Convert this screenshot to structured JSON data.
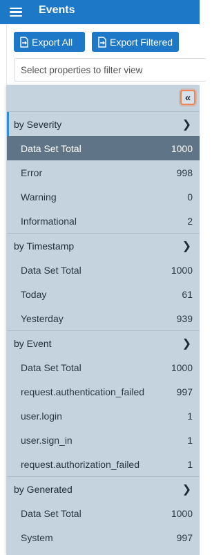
{
  "header": {
    "title": "Events",
    "menu_icon": "hamburger-menu-icon"
  },
  "toolbar": {
    "export_all_label": "Export All",
    "export_filtered_label": "Export Filtered",
    "filter_placeholder": "Select properties to filter view"
  },
  "panel": {
    "collapse_glyph": "«",
    "sections": [
      {
        "label": "by Severity",
        "rows": [
          {
            "label": "Data Set Total",
            "value": "1000"
          },
          {
            "label": "Error",
            "value": "998"
          },
          {
            "label": "Warning",
            "value": "0"
          },
          {
            "label": "Informational",
            "value": "2"
          }
        ]
      },
      {
        "label": "by Timestamp",
        "rows": [
          {
            "label": "Data Set Total",
            "value": "1000"
          },
          {
            "label": "Today",
            "value": "61"
          },
          {
            "label": "Yesterday",
            "value": "939"
          }
        ]
      },
      {
        "label": "by Event",
        "rows": [
          {
            "label": "Data Set Total",
            "value": "1000"
          },
          {
            "label": "request.authentication_failed",
            "value": "997"
          },
          {
            "label": "user.login",
            "value": "1"
          },
          {
            "label": "user.sign_in",
            "value": "1"
          },
          {
            "label": "request.authorization_failed",
            "value": "1"
          }
        ]
      },
      {
        "label": "by Generated",
        "rows": [
          {
            "label": "Data Set Total",
            "value": "1000"
          },
          {
            "label": "System",
            "value": "997"
          }
        ]
      }
    ]
  },
  "colors": {
    "brand": "#1e78c8",
    "panel_bg": "#c5d3de",
    "selected_row": "#5f7587",
    "highlight": "#e8875a"
  }
}
